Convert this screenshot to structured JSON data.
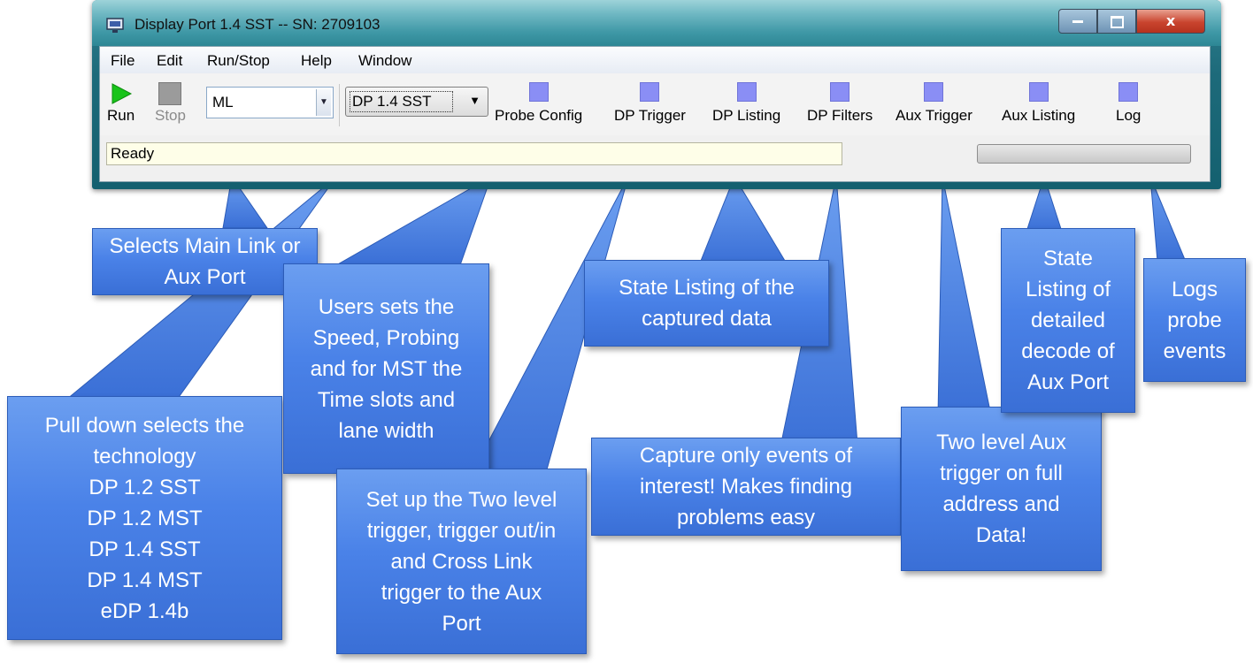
{
  "window": {
    "title": "Display Port 1.4 SST -- SN: 2709103",
    "controls": {
      "minimize": "",
      "maximize": "",
      "close": "x"
    }
  },
  "menu": [
    "File",
    "Edit",
    "Run/Stop",
    "Help",
    "Window"
  ],
  "toolbar": {
    "run_label": "Run",
    "stop_label": "Stop",
    "port_select_value": "ML",
    "technology_select_value": "DP 1.4 SST",
    "buttons": [
      "Probe Config",
      "DP Trigger",
      "DP Listing",
      "DP Filters",
      "Aux Trigger",
      "Aux Listing",
      "Log"
    ]
  },
  "status": {
    "text": "Ready",
    "progress": 0
  },
  "colors": {
    "callout_fill": "#4a82e8",
    "tool_icon": "#8a8ef5",
    "run_icon": "#19c41a",
    "title_bar": "#3f98a6",
    "status_field": "#fefee8"
  },
  "icons": {
    "run": "play-icon",
    "stop": "stop-icon",
    "tools": "square-icon",
    "app": "monitor-icon",
    "dropdown": "chevron-down-icon"
  },
  "callouts": {
    "port_select": [
      "Selects Main Link or",
      "Aux Port"
    ],
    "technology": [
      "Pull down selects the",
      "technology",
      "DP 1.2 SST",
      "DP 1.2 MST",
      "DP 1.4 SST",
      "DP 1.4 MST",
      "eDP 1.4b"
    ],
    "probe_config": [
      "Users sets the",
      "Speed, Probing",
      "and for MST the",
      "Time slots and",
      "lane width"
    ],
    "dp_trigger": [
      "Set up the Two level",
      "trigger, trigger out/in",
      "and Cross Link",
      "trigger to the Aux",
      "Port"
    ],
    "dp_listing": [
      "State Listing of the",
      "captured data"
    ],
    "dp_filters": [
      "Capture only events of",
      "interest!  Makes finding",
      "problems easy"
    ],
    "aux_trigger": [
      "Two level Aux",
      "trigger on full",
      "address and",
      "Data!"
    ],
    "aux_listing": [
      "State",
      "Listing of",
      "detailed",
      "decode of",
      "Aux Port"
    ],
    "log": [
      "Logs",
      "probe",
      "events"
    ]
  }
}
